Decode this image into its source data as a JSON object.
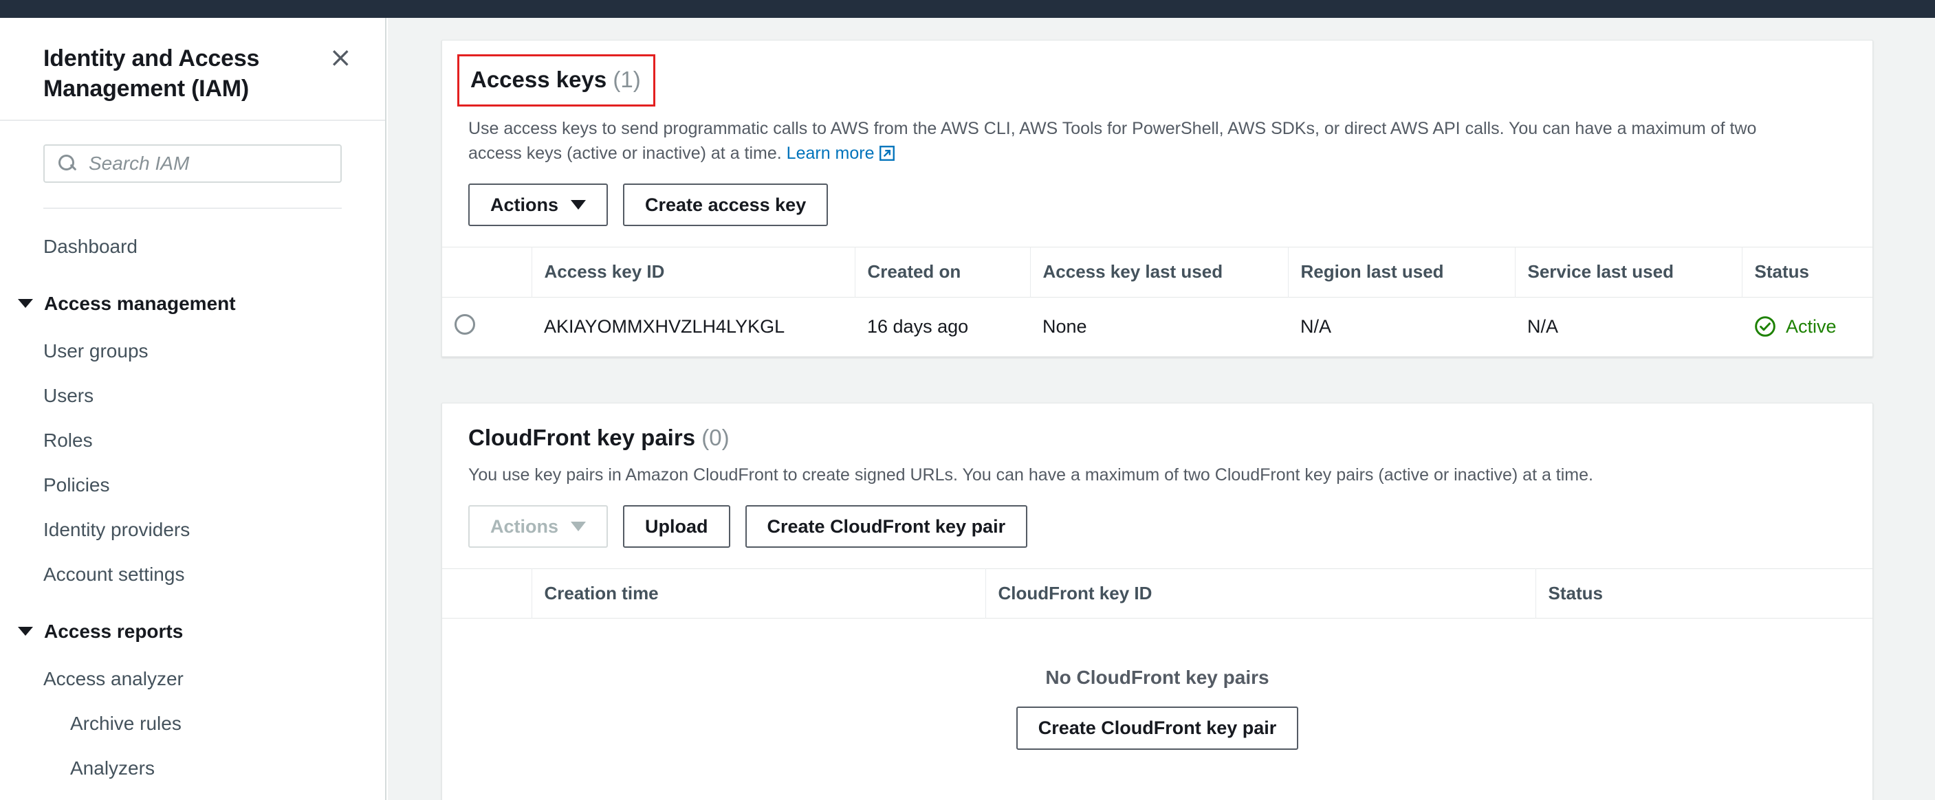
{
  "topbar": {
    "present": true
  },
  "sidebar": {
    "title": "Identity and Access Management (IAM)",
    "close_label": "×",
    "search": {
      "placeholder": "Search IAM",
      "value": ""
    },
    "items": [
      {
        "label": "Dashboard",
        "type": "link",
        "indent": 1
      },
      {
        "label": "Access management",
        "type": "group",
        "indent": 0
      },
      {
        "label": "User groups",
        "type": "link",
        "indent": 1
      },
      {
        "label": "Users",
        "type": "link",
        "indent": 1
      },
      {
        "label": "Roles",
        "type": "link",
        "indent": 1
      },
      {
        "label": "Policies",
        "type": "link",
        "indent": 1
      },
      {
        "label": "Identity providers",
        "type": "link",
        "indent": 1
      },
      {
        "label": "Account settings",
        "type": "link",
        "indent": 1
      },
      {
        "label": "Access reports",
        "type": "group",
        "indent": 0
      },
      {
        "label": "Access analyzer",
        "type": "link",
        "indent": 1
      },
      {
        "label": "Archive rules",
        "type": "link",
        "indent": 2
      },
      {
        "label": "Analyzers",
        "type": "link",
        "indent": 2
      }
    ]
  },
  "access_keys": {
    "title": "Access keys",
    "count": "(1)",
    "description": "Use access keys to send programmatic calls to AWS from the AWS CLI, AWS Tools for PowerShell, AWS SDKs, or direct AWS API calls. You can have a maximum of two access keys (active or inactive) at a time. ",
    "learn_more": "Learn more",
    "actions_label": "Actions",
    "create_label": "Create access key",
    "columns": [
      "",
      "Access key ID",
      "Created on",
      "Access key last used",
      "Region last used",
      "Service last used",
      "Status"
    ],
    "rows": [
      {
        "access_key_id": "AKIAYOMMXHVZLH4LYKGL",
        "created_on": "16 days ago",
        "access_key_last_used": "None",
        "region_last_used": "N/A",
        "service_last_used": "N/A",
        "status": "Active"
      }
    ]
  },
  "cloudfront": {
    "title": "CloudFront key pairs",
    "count": "(0)",
    "description": "You use key pairs in Amazon CloudFront to create signed URLs. You can have a maximum of two CloudFront key pairs (active or inactive) at a time.",
    "actions_label": "Actions",
    "upload_label": "Upload",
    "create_label": "Create CloudFront key pair",
    "columns": [
      "",
      "Creation time",
      "CloudFront key ID",
      "Status"
    ],
    "empty_title": "No CloudFront key pairs",
    "empty_button": "Create CloudFront key pair"
  },
  "colors": {
    "topbar": "#232f3e",
    "page_bg": "#f1f3f3",
    "accent_link": "#0073bb",
    "status_active": "#1d8102",
    "highlight_border": "#e32020"
  }
}
